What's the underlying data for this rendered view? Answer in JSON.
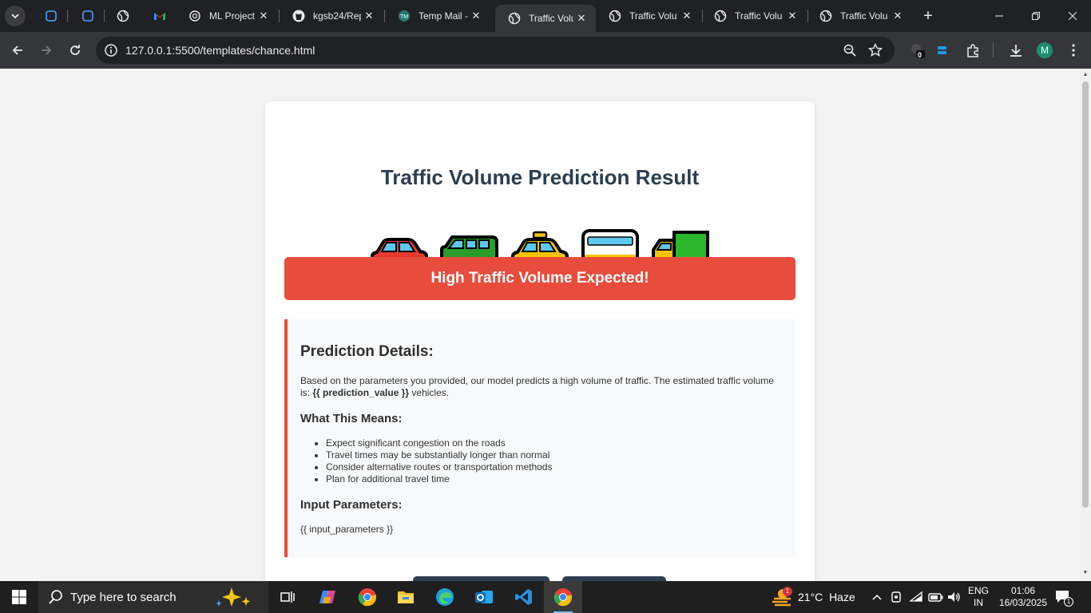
{
  "browser": {
    "tabs": [
      {
        "title": "",
        "favicon": "copilot-square-icon"
      },
      {
        "title": "",
        "favicon": "copilot-square-icon"
      },
      {
        "title": "",
        "favicon": "globe-icon"
      },
      {
        "title": "",
        "favicon": "gmail-icon"
      },
      {
        "title": "ML Project",
        "favicon": "openai-icon"
      },
      {
        "title": "kgsb24/Rep",
        "favicon": "github-icon"
      },
      {
        "title": "Temp Mail -",
        "favicon": "tempmail-icon"
      },
      {
        "title": "Traffic Volu",
        "favicon": "globe-icon",
        "active": true
      },
      {
        "title": "Traffic Volu",
        "favicon": "globe-icon"
      },
      {
        "title": "Traffic Volu",
        "favicon": "globe-icon"
      },
      {
        "title": "Traffic Volu",
        "favicon": "globe-icon"
      }
    ],
    "url": "127.0.0.1:5500/templates/chance.html",
    "extension_badge": "0",
    "profile_initial": "M"
  },
  "page": {
    "title": "Traffic Volume Prediction Result",
    "vehicles": [
      "car",
      "suv",
      "taxi",
      "bus",
      "truck"
    ],
    "banner": "High Traffic Volume Expected!",
    "details": {
      "heading": "Prediction Details:",
      "text_before": "Based on the parameters you provided, our model predicts a high volume of traffic. The estimated traffic volume is: ",
      "prediction_value": "{{ prediction_value }}",
      "text_after": " vehicles.",
      "means_heading": "What This Means:",
      "means_items": [
        "Expect significant congestion on the roads",
        "Travel times may be substantially longer than normal",
        "Consider alternative routes or transportation methods",
        "Plan for additional travel time"
      ],
      "params_heading": "Input Parameters:",
      "params_value": "{{ input_parameters }}"
    },
    "colors": {
      "heading": "#2c3e50",
      "alert": "#e74c3c",
      "panel": "#f8f9fa"
    }
  },
  "taskbar": {
    "search_placeholder": "Type here to search",
    "weather": {
      "temp": "21°C",
      "condition": "Haze",
      "badge": "1"
    },
    "language": {
      "line1": "ENG",
      "line2": "IN"
    },
    "time": "01:06",
    "date": "16/03/2025",
    "notification_count": "1"
  }
}
